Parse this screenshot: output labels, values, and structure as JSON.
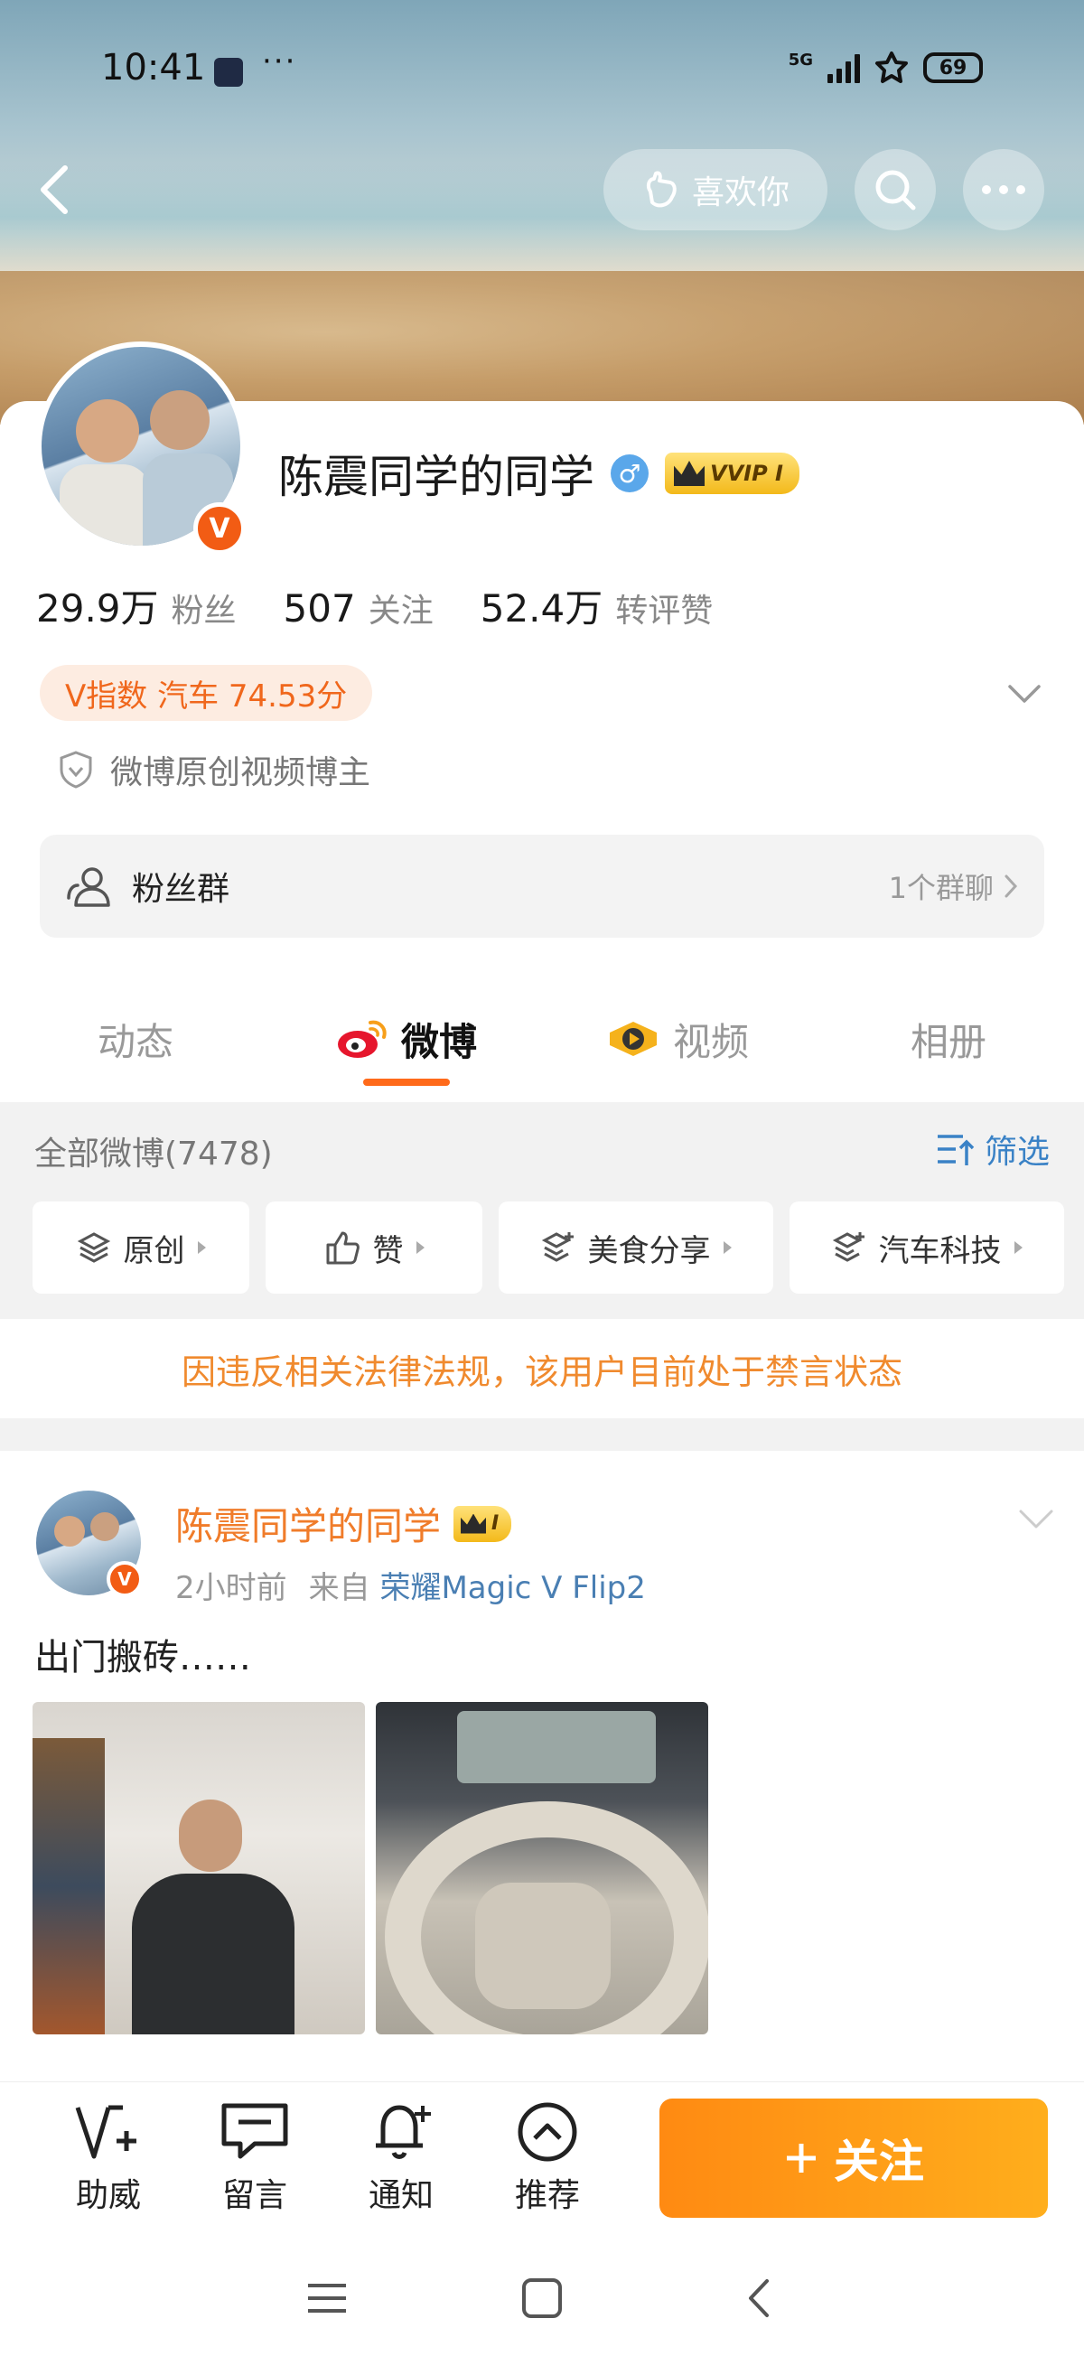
{
  "status": {
    "time": "10:41",
    "network": "5G",
    "battery": "69"
  },
  "header": {
    "like_label": "喜欢你"
  },
  "profile": {
    "name": "陈震同学的同学",
    "gender": "♂",
    "vip_label": "VVIP I",
    "stats": [
      {
        "num": "29.9万",
        "label": "粉丝"
      },
      {
        "num": "507",
        "label": "关注"
      },
      {
        "num": "52.4万",
        "label": "转评赞"
      }
    ],
    "v_index": "V指数 汽车 74.53分",
    "cert": "微博原创视频博主",
    "fans_group": {
      "label": "粉丝群",
      "count": "1个群聊"
    }
  },
  "tabs": [
    {
      "label": "动态",
      "active": false
    },
    {
      "label": "微博",
      "active": true
    },
    {
      "label": "视频",
      "active": false
    },
    {
      "label": "相册",
      "active": false
    }
  ],
  "feed": {
    "all_label": "全部微博(7478)",
    "filter_label": "筛选",
    "chips": [
      "原创",
      "赞",
      "美食分享",
      "汽车科技"
    ],
    "ban_notice": "因违反相关法律法规，该用户目前处于禁言状态"
  },
  "post": {
    "author": "陈震同学的同学",
    "vip_label": "I",
    "time": "2小时前",
    "from_prefix": "来自",
    "source": "荣耀Magic V Flip2",
    "text": "出门搬砖……"
  },
  "bottom": {
    "items": [
      "助威",
      "留言",
      "通知",
      "推荐"
    ],
    "follow_label": "关注"
  },
  "colors": {
    "accent": "#ff8a12",
    "link": "#3a82c6",
    "orange_text": "#f07c2a"
  }
}
